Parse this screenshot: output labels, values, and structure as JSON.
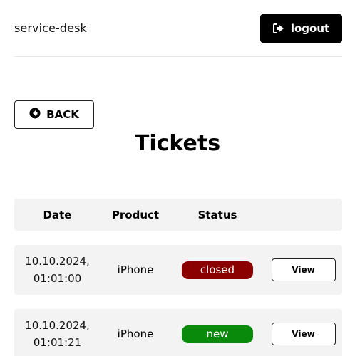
{
  "header": {
    "app_title": "service-desk",
    "logout_label": "logout",
    "logout_icon": "sign-out-icon"
  },
  "back": {
    "label": "BACK",
    "icon": "arrow-circle-left-icon"
  },
  "page_title": "Tickets",
  "table": {
    "columns": [
      "Date",
      "Product",
      "Status",
      ""
    ],
    "rows": [
      {
        "date_line1": "10.10.2024,",
        "date_line2": "01:01:00",
        "product": "iPhone",
        "status": "closed",
        "status_color": "#8b0000",
        "action": "View"
      },
      {
        "date_line1": "10.10.2024,",
        "date_line2": "01:01:21",
        "product": "iPhone",
        "status": "new",
        "status_color": "#0a8a0a",
        "action": "View"
      }
    ]
  }
}
